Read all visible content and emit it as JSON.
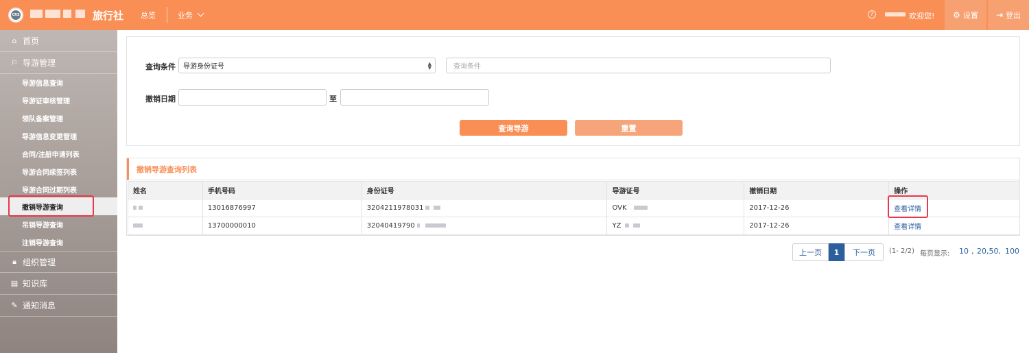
{
  "header": {
    "brand": "旅行社",
    "logo_text": "CRS",
    "nav": [
      "总览",
      "业务"
    ],
    "help_icon": "question-circle-icon",
    "welcome": "欢迎您!",
    "settings_label": "设置",
    "settings_icon": "gear-icon",
    "logout_label": "登出",
    "logout_icon": "sign-out-icon",
    "colors": {
      "header_bg": "#fa8f55",
      "header_btn_bg": "#f7a071"
    }
  },
  "sidebar": {
    "home": {
      "label": "首页",
      "icon": "home-icon"
    },
    "guide_mgmt": {
      "label": "导游管理",
      "icon": "flag-icon"
    },
    "sub_items": [
      "导游信息查询",
      "导游证审核管理",
      "领队备案管理",
      "导游信息变更管理",
      "合同/注册申请列表",
      "导游合同续签列表",
      "导游合同过期列表",
      "撤销导游查询",
      "吊销导游查询",
      "注销导游查询"
    ],
    "active_index": 7,
    "org_mgmt": {
      "label": "组织管理",
      "icon": "lock-icon"
    },
    "knowledge": {
      "label": "知识库",
      "icon": "book-icon"
    },
    "notice": {
      "label": "通知消息",
      "icon": "edit-icon"
    }
  },
  "search": {
    "cond_label": "查询条件",
    "cond_select_value": "导游身份证号",
    "cond_input_placeholder": "查询条件",
    "date_label": "撤销日期",
    "date_sep": "至",
    "query_button": "查询导游",
    "reset_button": "重置",
    "colors": {
      "query_bg": "#fa8f55",
      "reset_bg": "#f6a57b"
    }
  },
  "results": {
    "title": "撤销导游查询列表",
    "columns": [
      "姓名",
      "手机号码",
      "身份证号",
      "导游证号",
      "撤销日期",
      "操作"
    ],
    "rows": [
      {
        "name": "",
        "phone": "13016876997",
        "id": "3204211978031",
        "guide": "OVK",
        "date": "2017-12-26",
        "action": "查看详情"
      },
      {
        "name": "",
        "phone": "13700000010",
        "id": "32040419790",
        "guide": "YZ",
        "date": "2017-12-26",
        "action": "查看详情"
      }
    ]
  },
  "pagination": {
    "prev": "上一页",
    "current": "1",
    "next": "下一页",
    "info": "(1- 2/2)",
    "per_page_label": "每页显示:",
    "size_10": "10",
    "comma": ",",
    "size_20": "20",
    "size_50": ",50,",
    "size_100": "100"
  }
}
